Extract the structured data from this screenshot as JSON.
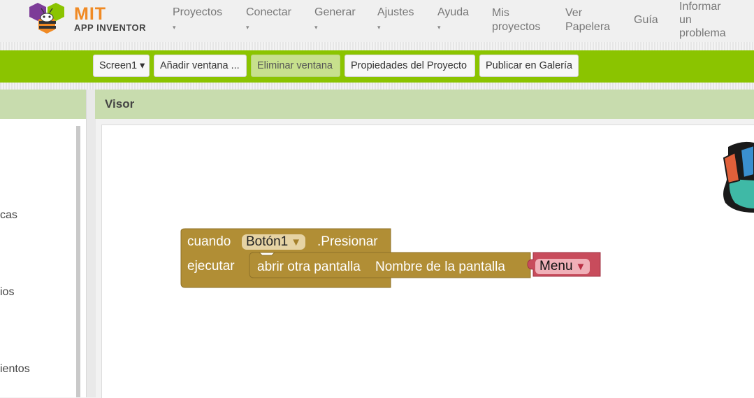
{
  "app": {
    "logo_line1": "MIT",
    "logo_line2": "APP INVENTOR",
    "brand_color": "#f08a24"
  },
  "nav": {
    "proyectos": "Proyectos",
    "conectar": "Conectar",
    "generar": "Generar",
    "ajustes": "Ajustes",
    "ayuda": "Ayuda",
    "mis_proyectos_1": "Mis",
    "mis_proyectos_2": "proyectos",
    "ver_papelera_1": "Ver",
    "ver_papelera_2": "Papelera",
    "guia": "Guía",
    "informar_1": "Informar",
    "informar_2": "un",
    "informar_3": "problema",
    "caret": "▾"
  },
  "toolbar": {
    "color": "#8bc400",
    "screen_select": "Screen1 ▾",
    "add_screen": "Añadir ventana ...",
    "remove_screen": "Eliminar ventana",
    "project_properties": "Propiedades del Proyecto",
    "publish_gallery": "Publicar en Galería"
  },
  "left_panel": {
    "labels": [
      "cas",
      "ios",
      "ientos"
    ]
  },
  "viewer": {
    "title": "Visor"
  },
  "blocks": {
    "event_keyword": "cuando",
    "component": "Botón1",
    "event_name": ".Presionar",
    "do_keyword": "ejecutar",
    "open_screen": "abrir otra pantalla",
    "screen_name_label": "Nombre de la pantalla",
    "screen_value": "Menu",
    "dropdown_arrow": "▼",
    "event_color": "#b18e35",
    "text_color": "#c84c5c"
  }
}
